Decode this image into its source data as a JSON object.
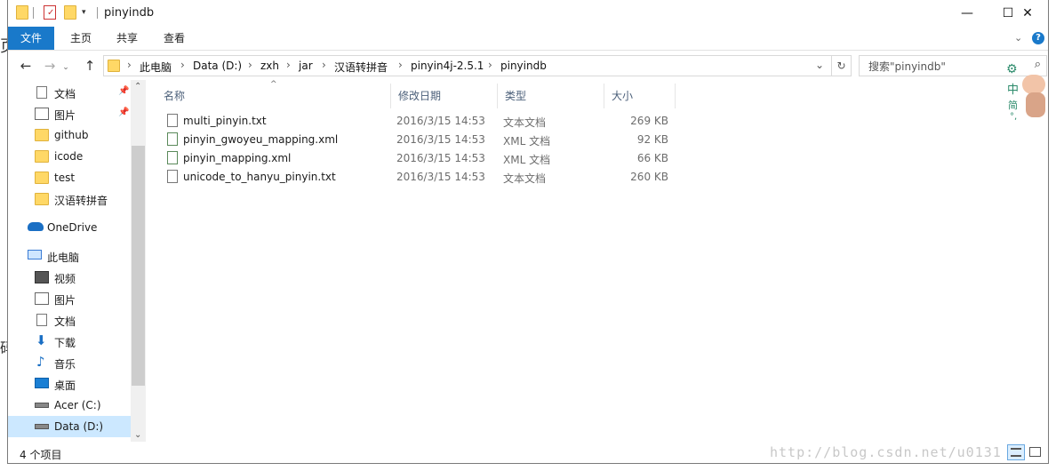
{
  "window": {
    "title": "pinyindb",
    "minimize": "—",
    "maximize": "☐",
    "close": "✕"
  },
  "ribbon": {
    "tabs": [
      "文件",
      "主页",
      "共享",
      "查看"
    ]
  },
  "nav": {
    "back": "←",
    "forward": "→",
    "up": "↑",
    "breadcrumb": [
      "此电脑",
      "Data (D:)",
      "zxh",
      "jar",
      "汉语转拼音",
      "pinyin4j-2.5.1",
      "pinyindb"
    ],
    "search_placeholder": "搜索\"pinyindb\""
  },
  "sidebar": {
    "quick_access": [
      {
        "label": "文档",
        "icon": "documents-icon",
        "pinned": true
      },
      {
        "label": "图片",
        "icon": "pictures-icon",
        "pinned": true
      },
      {
        "label": "github",
        "icon": "folder-icon",
        "pinned": false
      },
      {
        "label": "icode",
        "icon": "folder-icon",
        "pinned": false
      },
      {
        "label": "test",
        "icon": "folder-icon",
        "pinned": false
      },
      {
        "label": "汉语转拼音",
        "icon": "folder-icon",
        "pinned": false
      }
    ],
    "onedrive": "OneDrive",
    "this_pc": "此电脑",
    "pc_items": [
      {
        "label": "视频",
        "icon": "videos-icon"
      },
      {
        "label": "图片",
        "icon": "pictures-icon"
      },
      {
        "label": "文档",
        "icon": "documents-icon"
      },
      {
        "label": "下载",
        "icon": "downloads-icon"
      },
      {
        "label": "音乐",
        "icon": "music-icon"
      },
      {
        "label": "桌面",
        "icon": "desktop-icon"
      },
      {
        "label": "Acer (C:)",
        "icon": "drive-icon"
      },
      {
        "label": "Data (D:)",
        "icon": "drive-icon"
      }
    ],
    "selected": "Data (D:)"
  },
  "columns": [
    "名称",
    "修改日期",
    "类型",
    "大小"
  ],
  "files": [
    {
      "name": "multi_pinyin.txt",
      "date": "2016/3/15 14:53",
      "type": "文本文档",
      "size": "269 KB",
      "icon": "text-file-icon"
    },
    {
      "name": "pinyin_gwoyeu_mapping.xml",
      "date": "2016/3/15 14:53",
      "type": "XML 文档",
      "size": "92 KB",
      "icon": "xml-file-icon"
    },
    {
      "name": "pinyin_mapping.xml",
      "date": "2016/3/15 14:53",
      "type": "XML 文档",
      "size": "66 KB",
      "icon": "xml-file-icon"
    },
    {
      "name": "unicode_to_hanyu_pinyin.txt",
      "date": "2016/3/15 14:53",
      "type": "文本文档",
      "size": "260 KB",
      "icon": "text-file-icon"
    }
  ],
  "status": {
    "item_count": "4 个项目"
  },
  "overlay": {
    "ime": [
      "中",
      "简"
    ],
    "watermark": "http://blog.csdn.net/u0131"
  },
  "colors": {
    "accent": "#1979ca",
    "selected": "#cce8ff",
    "folder": "#ffd866",
    "header_text": "#4c607a"
  }
}
